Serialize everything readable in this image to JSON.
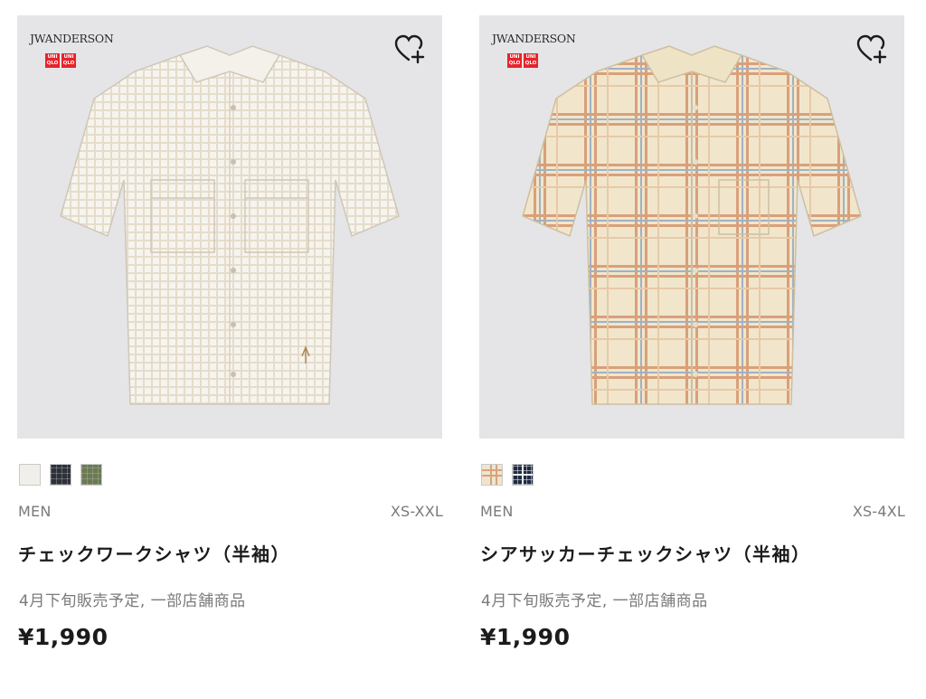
{
  "products": [
    {
      "brand_logo": "JWANDERSON",
      "uniqlo_logo": "UNIQLO",
      "favorite_icon": "heart-plus-icon",
      "colors": [
        "white-check",
        "navy-check",
        "olive-check"
      ],
      "gender": "MEN",
      "sizes": "XS-XXL",
      "name": "チェックワークシャツ（半袖）",
      "note": "4月下旬販売予定, 一部店舗商品",
      "price": "¥1,990"
    },
    {
      "brand_logo": "JWANDERSON",
      "uniqlo_logo": "UNIQLO",
      "favorite_icon": "heart-plus-icon",
      "colors": [
        "cream-check",
        "navy-check"
      ],
      "gender": "MEN",
      "sizes": "XS-4XL",
      "name": "シアサッカーチェックシャツ（半袖）",
      "note": "4月下旬販売予定, 一部店舗商品",
      "price": "¥1,990"
    }
  ]
}
